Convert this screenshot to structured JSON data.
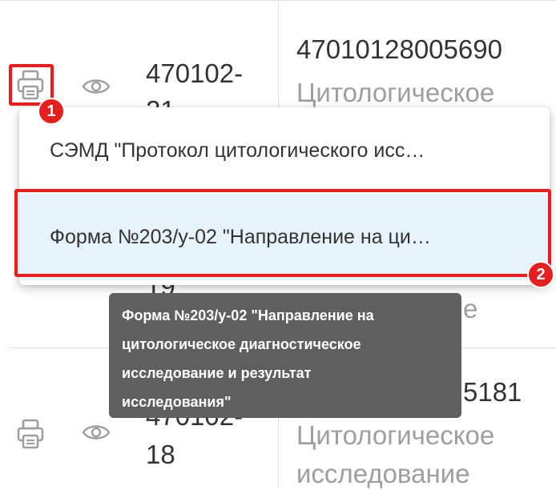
{
  "rows": [
    {
      "id_lines": [
        "470102-",
        "21"
      ],
      "number": "47010128005690",
      "type_lines": [
        "Цитологическое"
      ]
    },
    {
      "id_lines": [
        "19"
      ],
      "type_tail": "е"
    },
    {
      "id_lines": [
        "470102-",
        "18"
      ],
      "number_tail": "5181",
      "type_lines": [
        "Цитологическое",
        "исследование"
      ]
    }
  ],
  "dropdown": {
    "items": [
      {
        "label": "СЭМД \"Протокол цитологического исс…",
        "active": false
      },
      {
        "label": "Форма №203/у-02 \"Направление на ци…",
        "active": true
      }
    ]
  },
  "tooltip": {
    "lines": [
      "Форма №203/у-02 \"Направление на",
      "цитологическое диагностическое",
      "исследование и результат",
      "исследования\""
    ]
  },
  "annotations": {
    "badge_1": "1",
    "badge_2": "2",
    "accent_color": "#ee1b1b"
  },
  "colors": {
    "menu_active_bg": "#e6f3fa",
    "tooltip_bg": "#5f5f5f",
    "icon_gray": "#9e9e9e"
  },
  "icons": [
    "printer-icon",
    "eye-icon"
  ]
}
